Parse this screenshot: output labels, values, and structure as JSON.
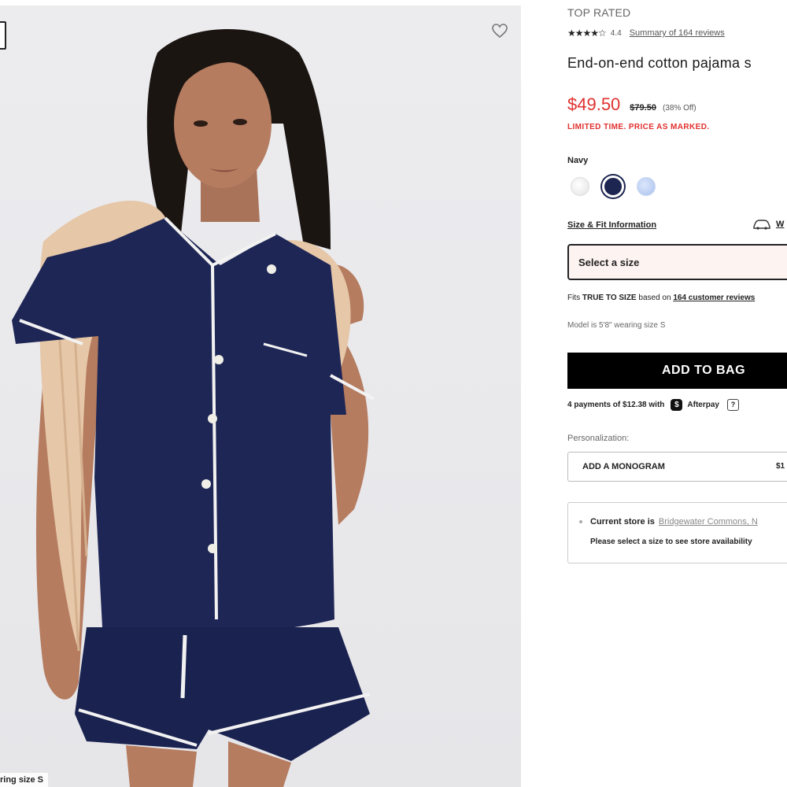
{
  "image": {
    "alt": "Model wearing navy short-sleeve pajama set with white piping and a tan sweater over her shoulders",
    "model_tag": "ring size S"
  },
  "product": {
    "badge": "TOP RATED",
    "stars": "★★★★☆",
    "rating": "4.4",
    "reviews_link": "Summary of 164 reviews",
    "title": "End-on-end cotton pajama s",
    "sale_price": "$49.50",
    "original_price": "$79.50",
    "discount": "(38% Off)",
    "promo": "LIMITED TIME. PRICE AS MARKED.",
    "color_label": "Navy",
    "swatches": [
      "white",
      "navy",
      "light-blue"
    ]
  },
  "fit": {
    "size_fit_link": "Size & Fit Information",
    "wishlist_link": "W",
    "select_size": "Select a size",
    "fits_prefix": "Fits ",
    "fits_bold": "TRUE TO SIZE",
    "fits_middle": " based on ",
    "fits_link": "164 customer reviews",
    "model_info": "Model is 5'8\" wearing size S"
  },
  "actions": {
    "add_to_bag": "ADD TO BAG",
    "afterpay_text": "4 payments of $12.38 with",
    "afterpay_brand": "Afterpay",
    "help": "?"
  },
  "personalization": {
    "label": "Personalization:",
    "monogram": "ADD A MONOGRAM",
    "monogram_price": "$1"
  },
  "store": {
    "label": "Current store is",
    "name": "Bridgewater Commons, N",
    "availability": "Please select a size to see store availability"
  },
  "colors": {
    "sale": "#e0312f",
    "navy": "#1d2650",
    "button": "#000000"
  }
}
